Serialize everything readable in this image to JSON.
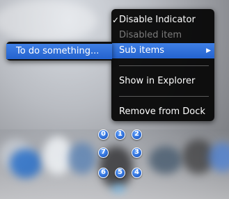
{
  "main_menu": {
    "items": [
      {
        "label": "Disable Indicator",
        "checked": true,
        "disabled": false
      },
      {
        "label": "Disabled item",
        "disabled": true
      },
      {
        "label": "Sub items",
        "has_submenu": true,
        "selected": true
      },
      {
        "label": "Show in Explorer"
      },
      {
        "label": "Remove from Dock"
      }
    ],
    "check_glyph": "✓",
    "submenu_arrow": "▶"
  },
  "sub_menu": {
    "items": [
      {
        "label": "To do something...",
        "selected": true
      }
    ]
  },
  "dock_badges": [
    "0",
    "1",
    "2",
    "7",
    "3",
    "6",
    "5",
    "4"
  ],
  "colors": {
    "menu_bg": "#080808",
    "highlight": "#2f6fd8",
    "disabled_text": "#7c7c7c",
    "badge_blue": "#2f6fd8"
  }
}
